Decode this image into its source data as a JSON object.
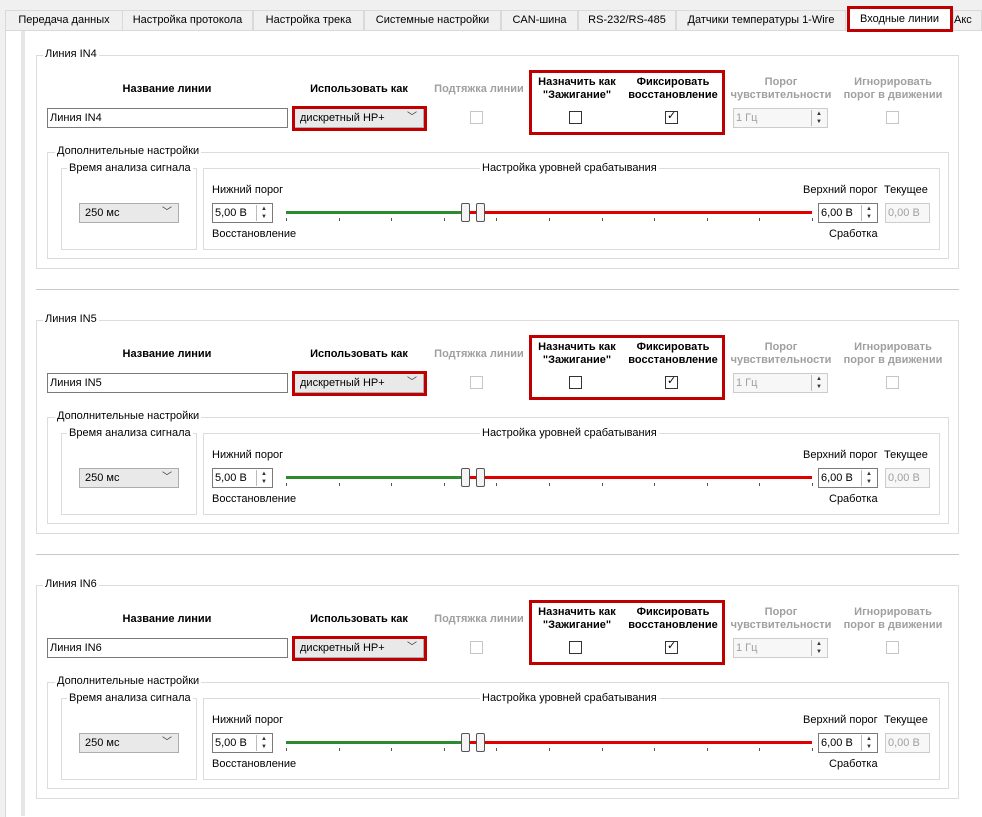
{
  "tabs": [
    "Передача данных",
    "Настройка протокола",
    "Настройка трека",
    "Системные настройки",
    "CAN-шина",
    "RS-232/RS-485",
    "Датчики температуры 1-Wire",
    "Входные линии",
    "Акс"
  ],
  "headers": {
    "name": "Название линии",
    "use_as": "Использовать как",
    "pullup": "Подтяжка линии",
    "ignition_1": "Назначить как",
    "ignition_2": "\"Зажигание\"",
    "fix_1": "Фиксировать",
    "fix_2": "восстановление",
    "thr_1": "Порог",
    "thr_2": "чувствительности",
    "ign_1": "Игнорировать",
    "ign_2": "порог в движении"
  },
  "labels": {
    "additional": "Дополнительные настройки",
    "analysis_time": "Время анализа сигнала",
    "levels": "Настройка уровней срабатывания",
    "lower": "Нижний порог",
    "upper": "Верхний порог",
    "current": "Текущее",
    "restore": "Восстановление",
    "trigger": "Сработка"
  },
  "lines": [
    {
      "group": "Линия IN4",
      "name": "Линия IN4",
      "use_as": "дискретный НР+",
      "pullup": false,
      "ignition": false,
      "fix_restore": true,
      "threshold": "1 Гц",
      "ignore_moving": false,
      "analysis": "250 мс",
      "lower": "5,00 В",
      "upper": "6,00 В",
      "current": "0,00 В",
      "low_frac": 0.34,
      "high_frac": 1.0
    },
    {
      "group": "Линия IN5",
      "name": "Линия IN5",
      "use_as": "дискретный НР+",
      "pullup": false,
      "ignition": false,
      "fix_restore": true,
      "threshold": "1 Гц",
      "ignore_moving": false,
      "analysis": "250 мс",
      "lower": "5,00 В",
      "upper": "6,00 В",
      "current": "0,00 В",
      "low_frac": 0.34,
      "high_frac": 1.0
    },
    {
      "group": "Линия IN6",
      "name": "Линия IN6",
      "use_as": "дискретный НР+",
      "pullup": false,
      "ignition": false,
      "fix_restore": true,
      "threshold": "1 Гц",
      "ignore_moving": false,
      "analysis": "250 мс",
      "lower": "5,00 В",
      "upper": "6,00 В",
      "current": "0,00 В",
      "low_frac": 0.34,
      "high_frac": 1.0
    }
  ],
  "colors": {
    "restore_line": "#2d8a2d",
    "trigger_line": "#e00000",
    "highlight": "#c00000"
  },
  "icons": {
    "combo": "chevron-down-icon",
    "spin": "spin-arrows-icon",
    "check": "check-icon"
  }
}
